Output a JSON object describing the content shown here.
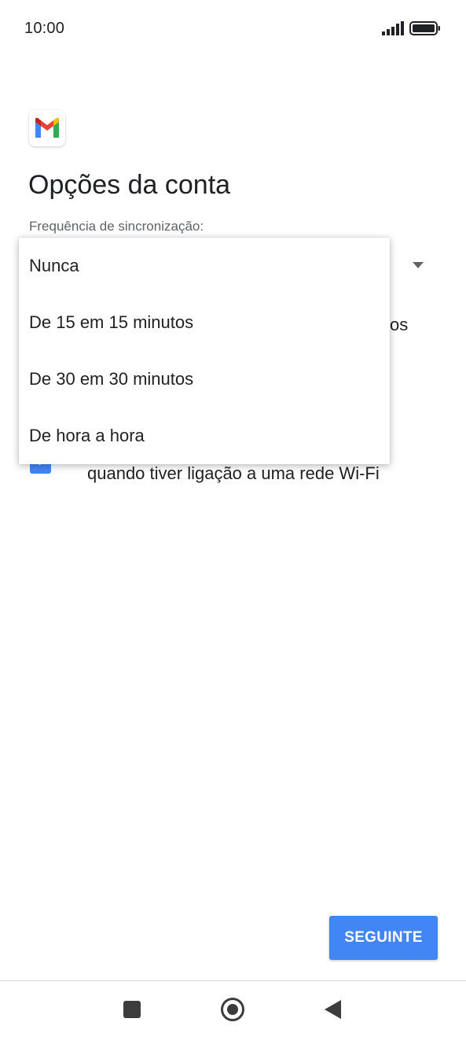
{
  "status_bar": {
    "time": "10:00",
    "icons": [
      "signal-icon",
      "battery-icon"
    ]
  },
  "header": {
    "app_icon": "gmail-icon",
    "title": "Opções da conta"
  },
  "sync_field": {
    "label": "Frequência de sincronização:"
  },
  "background": {
    "option_1_visible_tail": "os",
    "option_2_visible_text": "quando tiver ligação a uma rede Wi-Fi",
    "option_2_checked": true
  },
  "dropdown": {
    "items": [
      {
        "label": "Nunca"
      },
      {
        "label": "De 15 em 15 minutos"
      },
      {
        "label": "De 30 em 30 minutos"
      },
      {
        "label": "De hora a hora"
      }
    ]
  },
  "footer": {
    "next_label": "SEGUINTE"
  },
  "nav_bar": {
    "icons": [
      "recents-icon",
      "home-icon",
      "back-icon"
    ]
  },
  "colors": {
    "accent": "#4285f4",
    "text_primary": "#202124",
    "text_secondary": "#5f6368",
    "gmail_red": "#ea4335",
    "gmail_blue": "#4285f4",
    "gmail_green": "#34a853",
    "gmail_yellow": "#fbbc04",
    "gmail_dark_red": "#c5221f"
  }
}
